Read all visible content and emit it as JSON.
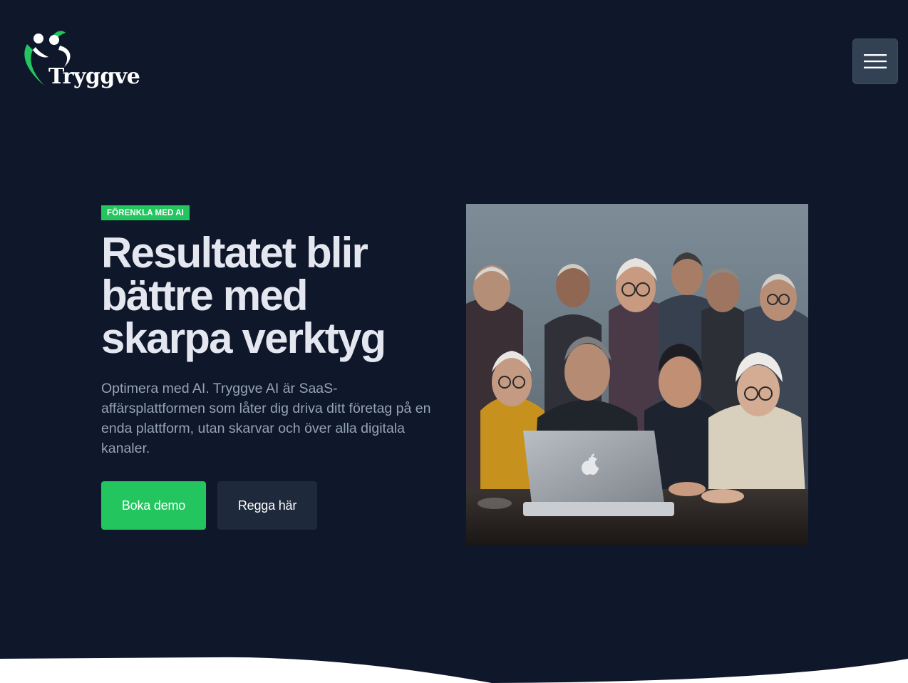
{
  "header": {
    "brand": "Tryggve",
    "colors": {
      "logo_green": "#22c55e",
      "logo_white": "#ffffff"
    },
    "menu_icon": "hamburger-icon"
  },
  "hero": {
    "badge": "FÖRENKLA MED AI",
    "title": "Resultatet blir bättre med skarpa verktyg",
    "description": "Optimera med AI. Tryggve AI är SaaS-affärsplattformen som låter dig driva ditt företag på en enda plattform, utan skarvar och över alla digitala kanaler.",
    "primary_button": "Boka demo",
    "secondary_button": "Regga här",
    "image_subject": "elderly-people-looking-at-laptop-illustration"
  },
  "colors": {
    "background": "#0f172a",
    "accent": "#22c55e",
    "secondary_button": "#1e293b",
    "menu_button": "#334155",
    "headline": "#e5e7f0",
    "body_text": "#94a3b8"
  }
}
